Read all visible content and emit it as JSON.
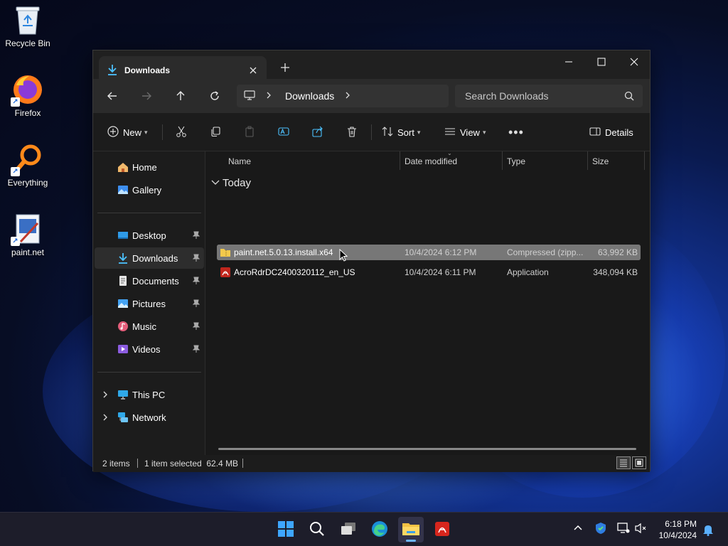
{
  "desktop": {
    "icons": [
      {
        "label": "Recycle Bin"
      },
      {
        "label": "Firefox"
      },
      {
        "label": "Everything"
      },
      {
        "label": "paint.net"
      }
    ]
  },
  "window": {
    "tab_title": "Downloads",
    "address_crumb": "Downloads",
    "search_placeholder": "Search Downloads",
    "commands": {
      "new_label": "New",
      "sort_label": "Sort",
      "view_label": "View",
      "details_label": "Details"
    },
    "nav": {
      "items": [
        {
          "label": "Home"
        },
        {
          "label": "Gallery"
        },
        {
          "label": "Desktop"
        },
        {
          "label": "Downloads"
        },
        {
          "label": "Documents"
        },
        {
          "label": "Pictures"
        },
        {
          "label": "Music"
        },
        {
          "label": "Videos"
        },
        {
          "label": "This PC"
        },
        {
          "label": "Network"
        }
      ]
    },
    "columns": {
      "name": "Name",
      "date": "Date modified",
      "type": "Type",
      "size": "Size"
    },
    "group_label": "Today",
    "files": [
      {
        "name": "paint.net.5.0.13.install.x64",
        "date": "10/4/2024 6:12 PM",
        "type": "Compressed (zipp...",
        "size": "63,992 KB"
      },
      {
        "name": "AcroRdrDC2400320112_en_US",
        "date": "10/4/2024 6:11 PM",
        "type": "Application",
        "size": "348,094 KB"
      }
    ],
    "status": {
      "items": "2 items",
      "selected": "1 item selected  62.4 MB"
    }
  },
  "taskbar": {
    "time": "6:18 PM",
    "date": "10/4/2024"
  },
  "colors": {
    "accent": "#4cc2ff",
    "selection": "#777777",
    "window_bg": "#1c1c1c"
  }
}
